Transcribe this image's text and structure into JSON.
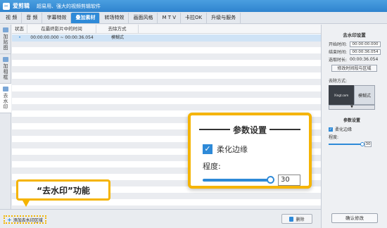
{
  "app": {
    "name": "爱剪辑",
    "slogan": "超易用、强大的视频剪辑软件"
  },
  "menu": [
    "视 频",
    "音 频",
    "字幕特效",
    "叠加素材",
    "转场特效",
    "画面风格",
    "M T V",
    "卡拉OK",
    "升级与服务"
  ],
  "left_tabs": [
    {
      "label": "加贴图"
    },
    {
      "label": "加相框"
    },
    {
      "label": "去水印"
    }
  ],
  "table": {
    "headers": [
      "状态",
      "在最终影片中的时间",
      "去除方式"
    ],
    "rows": [
      {
        "status": "•",
        "time": "00:00:00.000 ~ 00:00:36.054",
        "method": "模糊式"
      }
    ]
  },
  "bottom": {
    "add_label": "添加去水印区域",
    "delete_label": "删除"
  },
  "right_panel": {
    "title": "去水印设置",
    "start_label": "开始时间:",
    "start_value": "00:00:00.000",
    "end_label": "结束时间:",
    "end_value": "00:00:36.054",
    "duration_label": "选取时长:",
    "duration_value": "00:00:36.054",
    "modify_button": "修改时间段与区域",
    "method_label": "去除方式:",
    "preview_caption": "Xingt.com",
    "method_value": "模糊式",
    "params_title": "参数设置",
    "soften_label": "柔化边缘",
    "degree_label": "程度:",
    "degree_value": "30",
    "confirm_button": "确认修改"
  },
  "callout": {
    "title": "参数设置",
    "soften_label": "柔化边缘",
    "degree_label": "程度:",
    "degree_value": "30"
  },
  "label_callout": "“去水印”功能",
  "colors": {
    "accent": "#2e8ad8",
    "highlight": "#f5b400"
  }
}
